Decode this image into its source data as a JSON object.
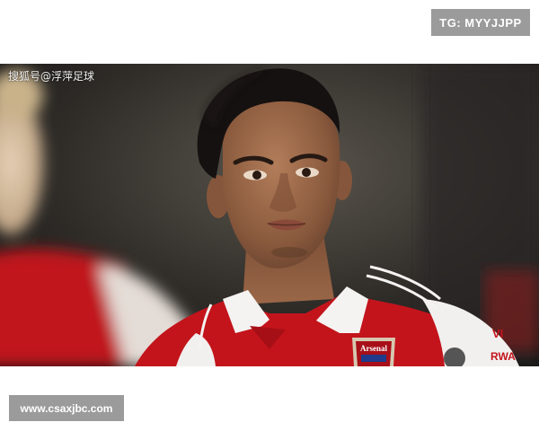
{
  "watermark_top": "TG: MYYJJPP",
  "photo": {
    "credit": "搜狐号@浮萍足球",
    "badge_text": "Arsenal"
  },
  "watermark_bottom": "www.csaxjbc.com"
}
